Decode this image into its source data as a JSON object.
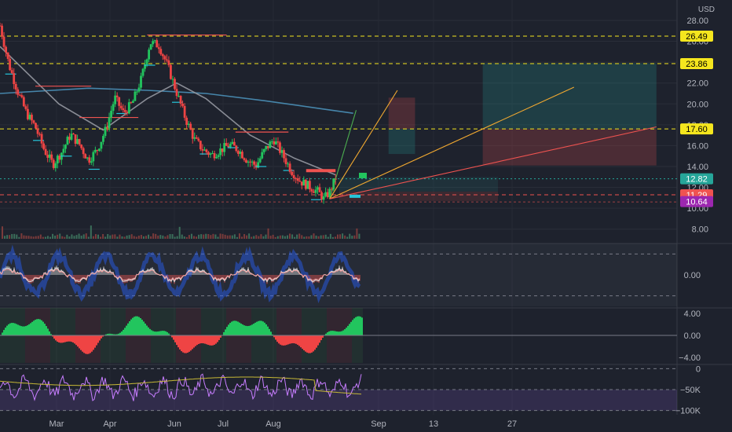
{
  "currency": "USD",
  "price_axis": {
    "min": 7.0,
    "max": 28.6,
    "ticks": [
      "28.00",
      "26.00",
      "24.00",
      "22.00",
      "20.00",
      "18.00",
      "16.00",
      "14.00",
      "12.00",
      "10.00",
      "8.00"
    ]
  },
  "time_axis": [
    "Mar",
    "Apr",
    "Jun",
    "Jul",
    "Aug",
    "Sep",
    "13",
    "27"
  ],
  "level_badges": [
    {
      "label": "26.49",
      "value": 26.49,
      "bg": "#f5e61e",
      "fg": "#000000",
      "line": "dashed-yellow"
    },
    {
      "label": "23.86",
      "value": 23.86,
      "bg": "#f5e61e",
      "fg": "#000000",
      "line": "dashed-yellow"
    },
    {
      "label": "17.60",
      "value": 17.6,
      "bg": "#f5e61e",
      "fg": "#000000",
      "line": "dashed-yellow"
    },
    {
      "label": "12.82",
      "value": 12.82,
      "bg": "#26a69a",
      "fg": "#ffffff",
      "line": "dotted-teal"
    },
    {
      "label": "11.29",
      "value": 11.29,
      "bg": "#ef5350",
      "fg": "#ffffff",
      "line": "dashed-red"
    },
    {
      "label": "10.64",
      "value": 10.64,
      "bg": "#9c27b0",
      "fg": "#ffffff",
      "line": "none"
    }
  ],
  "osc1": {
    "range": [
      -3,
      3
    ],
    "ticks": [
      "0.00"
    ]
  },
  "osc2": {
    "range": [
      -5,
      5
    ],
    "ticks": [
      "4.00",
      "0.00",
      "−4.00"
    ]
  },
  "osc3": {
    "range": [
      -110,
      10
    ],
    "ticks": [
      "0",
      "−50K",
      "−100K"
    ]
  },
  "chart_data": [
    {
      "type": "candlestick",
      "title": "",
      "ylabel": "USD",
      "ylim": [
        7.0,
        28.6
      ],
      "x": [
        "Mar",
        "Apr",
        "Jun",
        "Jul",
        "Aug",
        "Sep",
        "13",
        "27"
      ],
      "close_path": [
        [
          0,
          27.5
        ],
        [
          0.03,
          23.8
        ],
        [
          0.06,
          21.2
        ],
        [
          0.09,
          19.1
        ],
        [
          0.12,
          17.8
        ],
        [
          0.15,
          15.6
        ],
        [
          0.18,
          14.2
        ],
        [
          0.21,
          15.4
        ],
        [
          0.24,
          17.1
        ],
        [
          0.27,
          16.1
        ],
        [
          0.3,
          14.6
        ],
        [
          0.33,
          15.6
        ],
        [
          0.36,
          17.6
        ],
        [
          0.39,
          20.6
        ],
        [
          0.42,
          19.1
        ],
        [
          0.45,
          20.1
        ],
        [
          0.48,
          22.4
        ],
        [
          0.51,
          25.9
        ],
        [
          0.54,
          25.6
        ],
        [
          0.57,
          23.6
        ],
        [
          0.6,
          21.1
        ],
        [
          0.63,
          18.6
        ],
        [
          0.66,
          16.6
        ],
        [
          0.69,
          15.6
        ],
        [
          0.72,
          15.1
        ],
        [
          0.75,
          15.6
        ],
        [
          0.78,
          16.1
        ],
        [
          0.81,
          15.6
        ],
        [
          0.84,
          14.6
        ],
        [
          0.87,
          14.1
        ],
        [
          0.9,
          15.6
        ],
        [
          0.93,
          16.6
        ],
        [
          0.96,
          15.1
        ],
        [
          0.99,
          13.6
        ],
        [
          1.02,
          12.6
        ],
        [
          1.05,
          12.1
        ],
        [
          1.08,
          11.6
        ],
        [
          1.1,
          10.9
        ],
        [
          1.12,
          11.6
        ],
        [
          1.14,
          12.9
        ]
      ],
      "ma_slow": [
        [
          0,
          21.0
        ],
        [
          0.3,
          21.5
        ],
        [
          0.5,
          21.3
        ],
        [
          0.7,
          21.0
        ],
        [
          0.9,
          20.3
        ],
        [
          1.1,
          19.5
        ],
        [
          1.2,
          19.1
        ]
      ],
      "ma_fast": [
        [
          0,
          25.5
        ],
        [
          0.2,
          20.0
        ],
        [
          0.35,
          17.5
        ],
        [
          0.5,
          20.5
        ],
        [
          0.6,
          22.0
        ],
        [
          0.7,
          20.5
        ],
        [
          0.85,
          17.0
        ],
        [
          1.0,
          14.8
        ],
        [
          1.14,
          13.2
        ]
      ],
      "resistance_segments": [
        {
          "x": [
            0.5,
            0.77
          ],
          "y": 26.6
        },
        {
          "x": [
            0.12,
            0.31
          ],
          "y": 21.7
        },
        {
          "x": [
            0.27,
            0.47
          ],
          "y": 18.7
        },
        {
          "x": [
            0.8,
            0.98
          ],
          "y": 17.3
        },
        {
          "x": [
            1.04,
            1.14
          ],
          "y": 13.6
        }
      ],
      "horizontal_levels": [
        26.49,
        23.86,
        17.6,
        12.82,
        11.29
      ],
      "forecast_fan": [
        {
          "color": "#4caf50",
          "to": [
            1.21,
            19.4
          ]
        },
        {
          "color": "#f0a830",
          "to": [
            1.35,
            21.3
          ]
        },
        {
          "color": "#f0a830",
          "to": [
            1.95,
            21.6
          ]
        },
        {
          "color": "#ef5350",
          "to": [
            2.23,
            17.8
          ]
        }
      ],
      "projection_boxes": [
        {
          "x": [
            1.32,
            1.41
          ],
          "y": [
            17.6,
            20.6
          ],
          "color": "red"
        },
        {
          "x": [
            1.32,
            1.41
          ],
          "y": [
            15.2,
            17.6
          ],
          "color": "teal"
        },
        {
          "x": [
            1.64,
            2.23
          ],
          "y": [
            17.6,
            23.9
          ],
          "color": "teal"
        },
        {
          "x": [
            1.64,
            2.23
          ],
          "y": [
            14.1,
            17.6
          ],
          "color": "red"
        }
      ]
    }
  ]
}
